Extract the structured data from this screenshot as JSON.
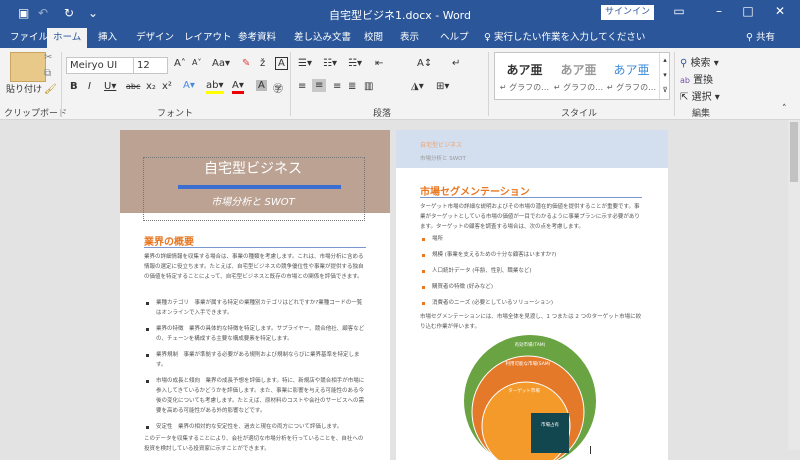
{
  "titlebar": {
    "title": "自宅型ビジネ1.docx  -  Word",
    "signin": "サインイン",
    "save_icon": "▣",
    "undo_icon": "↶",
    "redo_icon": "↻",
    "customize": "⌄"
  },
  "tabs": [
    "ファイル",
    "ホーム",
    "挿入",
    "デザイン",
    "レイアウト",
    "参考資料",
    "差し込み文書",
    "校閲",
    "表示",
    "ヘルプ"
  ],
  "tell_me": "実行したい作業を入力してください",
  "share": "共有",
  "ribbon": {
    "paste": "貼り付け",
    "clipboard": "クリップボード",
    "font_name": "Meiryo UI",
    "font_size": "12",
    "font_group": "フォント",
    "paragraph_group": "段落",
    "styles_group": "スタイル",
    "editing_group": "編集",
    "styles": [
      {
        "sample": "あア亜",
        "name": "↵ グラフの…"
      },
      {
        "sample": "あア亜",
        "name": "↵ グラフの…"
      },
      {
        "sample": "あア亜",
        "name": "↵ グラフの…"
      }
    ],
    "find": "検索",
    "replace": "置換",
    "select": "選択"
  },
  "page1": {
    "title": "自宅型ビジネス",
    "subtitle": "市場分析と SWOT",
    "heading": "業界の概要",
    "intro": "業界の詳細情報を収集する場合は、事業の種類を考慮します。これは、市場分析に含める情報の選定に役立ちます。たとえば、自宅型ビジネスの競争優位性や事業が提供する独自の価値を特定することによって、自宅型ビジネスと既存の市場との関係を評価できます。",
    "bullets": [
      "業種カテゴリ　事業が属する特定の業種別カテゴリはどれですか?業種コードの一覧はオンラインで入手できます。",
      "業界の特徴　業界の具体的な特徴を特定します。サプライヤー、競合他社、顧客などの、チェーンを構成する主要な構成要素を特定します。",
      "業界規制　事業が準拠する必要がある規則および規制ならびに業界基準を特定します。",
      "市場の成長と傾向　業界の成長予想を評価します。特に、新規店や競合相手が市場に参入してきているかどうかを評価します。また、事業に影響を与える可能性のある今後の変化についても考慮します。たとえば、原材料のコストや会社のサービスへの需要を高める可能性がある外的影響などです。",
      "安定性　業界の相対的な安定性を、過去と現在の両方について評価します。"
    ],
    "closing": "このデータを収集することにより、会社が適切な市場分析を行っていることを、自社への投資を検討している投資家に示すことができます。"
  },
  "page2": {
    "header_title": "自宅型ビジネス",
    "header_sub": "市場分析と SWOT",
    "heading": "市場セグメンテーション",
    "intro": "ターゲット市場の詳細な説明およびその市場の潜在的価値を提供することが重要です。事業がターゲットとしている市場の価値が一目でわかるように事業プランに示す必要があります。ターゲットの顧客を調査する場合は、次の点を考慮します。",
    "bullets": [
      "場所",
      "規模 (事業を支えるための十分な顧客はいますか?)",
      "人口統計データ (年齢、性別、職業など)",
      "購買者の特徴 (好みなど)",
      "消費者のニーズ (必要としているソリューション)"
    ],
    "closing": "市場セグメンテーションには、市場全体を見渡し、1 つまたは 2 つのターゲット市場に絞り込む作業が伴います。",
    "diagram": {
      "tam": "有効市場(TAM)",
      "sam": "利用可能な市場(SAM)",
      "target": "ターゲット市場",
      "share": "市場占有"
    }
  },
  "colors": {
    "word_blue": "#2b579a",
    "accent_orange": "#e87722",
    "tam": "#6aa342",
    "sam": "#e5792a",
    "target": "#f39a2a",
    "share": "#13474f"
  }
}
